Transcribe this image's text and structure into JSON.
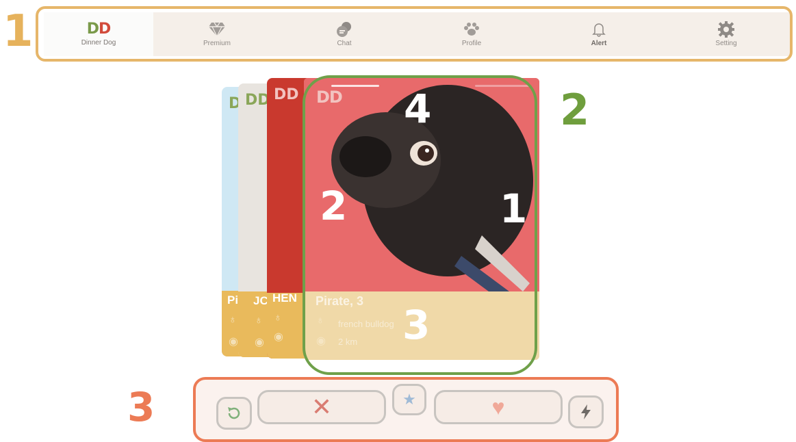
{
  "annotations": {
    "top_nav": "1",
    "card_area": "2",
    "action_bar": "3"
  },
  "nav": {
    "logo_mark": "DD",
    "logo_text": "Dinner Dog",
    "items": [
      {
        "label": "Premium",
        "icon": "diamond-icon"
      },
      {
        "label": "Chat",
        "icon": "chat-bubble-icon"
      },
      {
        "label": "Profile",
        "icon": "paw-icon"
      },
      {
        "label": "Alert",
        "icon": "bell-icon"
      },
      {
        "label": "Setting",
        "icon": "gear-icon"
      }
    ]
  },
  "card_stack": {
    "back_names": [
      "Pir",
      "JC",
      "HEN"
    ],
    "back_logo": "DD"
  },
  "card": {
    "logo": "DD",
    "name_age": "Pirate, 3",
    "breed": "french bulldog",
    "distance": "2 km",
    "overlay_labels": {
      "tap_right": "1",
      "tap_left": "2",
      "info": "3",
      "progress": "4"
    }
  },
  "actions": {
    "undo_icon": "rewind-icon",
    "nope_symbol": "✕",
    "super_symbol": "★",
    "like_symbol": "♥",
    "boost_icon": "lightning-icon"
  },
  "colors": {
    "frame_nav": "#e6b66a",
    "frame_card": "#6fa04a",
    "frame_actions": "#ec7b55"
  }
}
